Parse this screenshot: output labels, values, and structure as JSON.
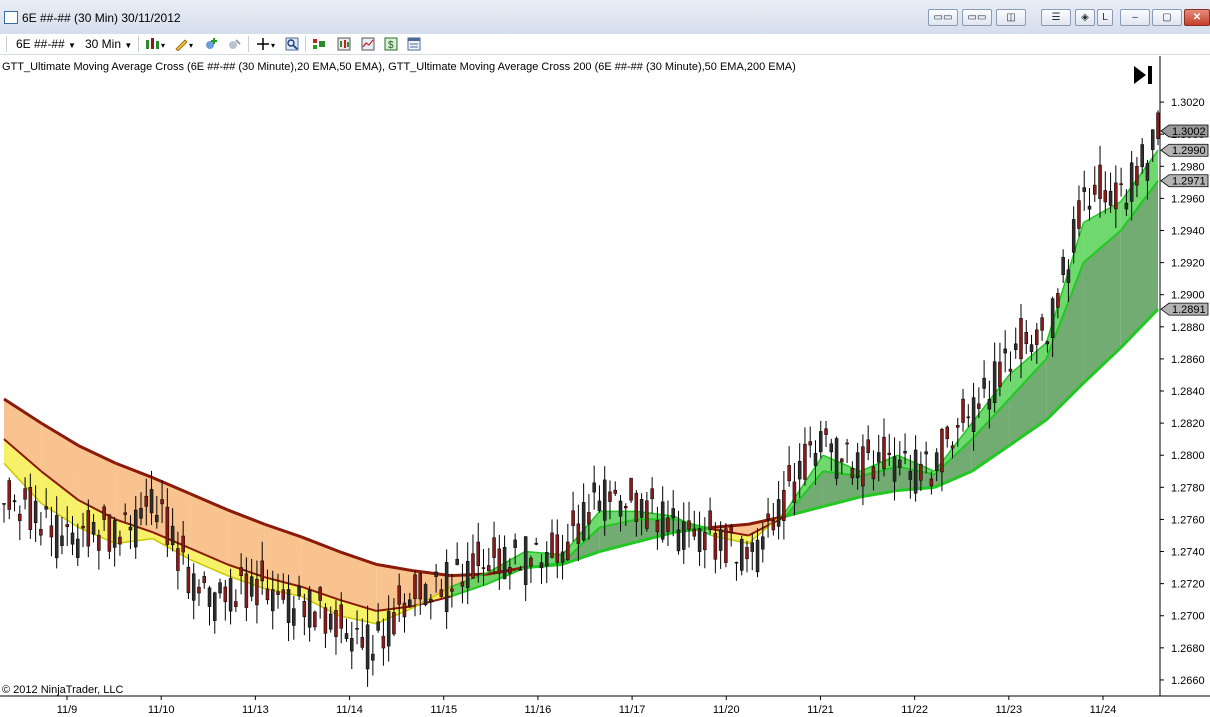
{
  "window": {
    "title": "6E ##-## (30 Min)  30/11/2012",
    "buttons": [
      "▭▭",
      "▭▭",
      "◫",
      "☰",
      "◈",
      "L",
      "–",
      "▢",
      "✕"
    ]
  },
  "toolbar": {
    "instrument": "6E ##-##",
    "interval": "30 Min",
    "icons": [
      "bar-type-icon",
      "draw-tool-icon",
      "add-indicator-icon",
      "remove-indicator-icon",
      "crosshair-icon",
      "zoom-icon",
      "strategy-icon",
      "chart-style-icon",
      "chart-data-icon",
      "dollar-icon",
      "properties-icon"
    ]
  },
  "indicator_label": "GTT_Ultimate Moving Average Cross (6E ##-## (30 Minute),20 EMA,50 EMA), GTT_Ultimate Moving Average Cross 200 (6E ##-## (30 Minute),50 EMA,200 EMA)",
  "copyright": "© 2012 NinjaTrader, LLC",
  "colors": {
    "candle_up": "#2e2e2e",
    "candle_down": "#8b1a1a",
    "bull_fill_fast": "#5fd45f",
    "bull_fill_slow": "#5a9e5a",
    "bear_fill_fast": "#f6f05a",
    "bear_fill_slow": "#f7b87a",
    "ema20_bear": "#c8c800",
    "ema50_bear": "#8b1a0a",
    "ema200_bear": "#8b1a0a",
    "ema_bull": "#22c822"
  },
  "chart_data": {
    "type": "line",
    "title": "",
    "ylim": [
      1.265,
      1.3035
    ],
    "y_ticks": [
      "1.2660",
      "1.2680",
      "1.2700",
      "1.2720",
      "1.2740",
      "1.2760",
      "1.2780",
      "1.2800",
      "1.2820",
      "1.2840",
      "1.2860",
      "1.2880",
      "1.2900",
      "1.2920",
      "1.2940",
      "1.2960",
      "1.2980",
      "1.3000",
      "1.3020"
    ],
    "x_ticks": [
      "11/9",
      "11/10",
      "11/13",
      "11/14",
      "11/15",
      "11/16",
      "11/17",
      "11/20",
      "11/21",
      "11/22",
      "11/23",
      "11/24"
    ],
    "price_markers": [
      "1.3002",
      "1.2990",
      "1.2971",
      "1.2891"
    ],
    "x": [
      0,
      4,
      8,
      12,
      16,
      20,
      24,
      28,
      32,
      36,
      40,
      44,
      48,
      52,
      56,
      60,
      64,
      68,
      72,
      76,
      80,
      84,
      88,
      92,
      96,
      100,
      104,
      108,
      112,
      116,
      120,
      124
    ],
    "series": [
      {
        "name": "Price",
        "values": [
          1.277,
          1.276,
          1.275,
          1.275,
          1.2775,
          1.272,
          1.2715,
          1.2715,
          1.271,
          1.269,
          1.2685,
          1.271,
          1.2725,
          1.273,
          1.274,
          1.2735,
          1.278,
          1.2765,
          1.276,
          1.2745,
          1.274,
          1.277,
          1.2815,
          1.279,
          1.28,
          1.279,
          1.283,
          1.286,
          1.2875,
          1.296,
          1.296,
          1.3002
        ]
      },
      {
        "name": "EMA 20",
        "values": [
          1.2795,
          1.277,
          1.2755,
          1.2745,
          1.2748,
          1.2735,
          1.2725,
          1.2717,
          1.2712,
          1.27,
          1.2695,
          1.2705,
          1.2718,
          1.2727,
          1.274,
          1.2738,
          1.2765,
          1.2765,
          1.2762,
          1.275,
          1.2745,
          1.2765,
          1.28,
          1.279,
          1.28,
          1.279,
          1.282,
          1.285,
          1.287,
          1.2945,
          1.2958,
          1.299
        ]
      },
      {
        "name": "EMA 50",
        "values": [
          1.281,
          1.279,
          1.2772,
          1.276,
          1.2752,
          1.2742,
          1.2732,
          1.2724,
          1.2718,
          1.271,
          1.2703,
          1.2706,
          1.2712,
          1.272,
          1.273,
          1.2733,
          1.2755,
          1.276,
          1.276,
          1.2754,
          1.275,
          1.2762,
          1.279,
          1.2787,
          1.2793,
          1.2788,
          1.281,
          1.2835,
          1.286,
          1.292,
          1.294,
          1.2971
        ]
      },
      {
        "name": "EMA 200",
        "values": [
          1.2835,
          1.282,
          1.2806,
          1.2795,
          1.2786,
          1.2776,
          1.2766,
          1.2757,
          1.2749,
          1.274,
          1.2732,
          1.2728,
          1.2725,
          1.2726,
          1.273,
          1.2732,
          1.274,
          1.2746,
          1.2752,
          1.2755,
          1.2757,
          1.2762,
          1.2768,
          1.2774,
          1.2778,
          1.278,
          1.279,
          1.2806,
          1.2822,
          1.2845,
          1.2867,
          1.2891
        ]
      }
    ]
  }
}
